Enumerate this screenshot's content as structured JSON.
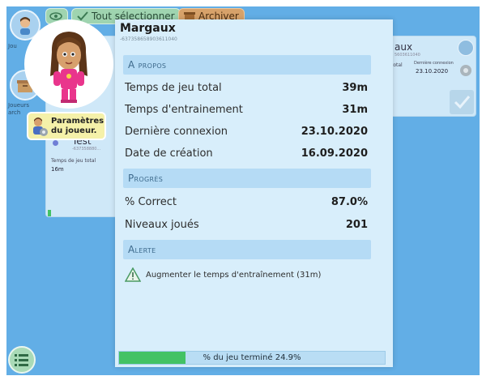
{
  "rail": {
    "top_label": "Jou",
    "archive_label": "Joueurs\narch"
  },
  "toolbar": {
    "select_all_label": "Tout sélectionner",
    "archive_label": "Archiver"
  },
  "bg_card_left": {
    "name": "Test",
    "id": "-637358880...",
    "total_label": "Temps de jeu total",
    "total_value": "16m"
  },
  "bg_card_right": {
    "name": "aux",
    "id": "5603611040",
    "total_label": "total",
    "conn_label": "Dernière connexion",
    "conn_value": "23.10.2020"
  },
  "popup": {
    "player_name": "Margaux",
    "player_id": "-637358658903611040",
    "sections": {
      "about": "A propos",
      "progress": "Progrès",
      "alert": "Alerte"
    },
    "stats": [
      {
        "label": "Temps de jeu total",
        "value": "39m"
      },
      {
        "label": "Temps d'entrainement",
        "value": "31m"
      },
      {
        "label": "Dernière connexion",
        "value": "23.10.2020"
      },
      {
        "label": "Date de création",
        "value": "16.09.2020"
      }
    ],
    "progress_stats": [
      {
        "label": "% Correct",
        "value": "87.0%"
      },
      {
        "label": "Niveaux joués",
        "value": "201"
      }
    ],
    "alert_text": "Augmenter le temps d'entraînement (31m)",
    "completion_label": "% du jeu terminé 24.9%",
    "completion_fraction": 0.249
  },
  "params_button": {
    "line1": "Paramètres",
    "line2": "du joueur."
  },
  "colors": {
    "background": "#62aee6",
    "popup": "#d8eefb",
    "section": "#b5dbf5",
    "progress_fill": "#43c265"
  }
}
